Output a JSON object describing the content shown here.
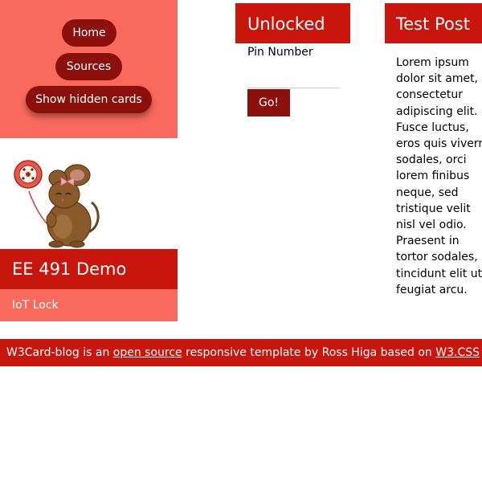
{
  "nav": {
    "home_label": "Home",
    "sources_label": "Sources",
    "hidden_cards_label": "Show hidden cards"
  },
  "profile": {
    "title": "EE 491 Demo",
    "subtitle": "IoT Lock",
    "mascot_icon": "mouse-with-balloon-icon"
  },
  "lock": {
    "status": "Unlocked",
    "pin_label": "Pin Number",
    "pin_value": "",
    "go_label": "Go!"
  },
  "post": {
    "title": "Test Post",
    "lines": [
      "Lorem ipsum",
      "dolor sit amet,",
      "consectetur",
      "adipiscing elit.",
      "Fusce luctus,",
      "eros quis viverra",
      "sodales, orci",
      "lorem finibus",
      "neque, sed",
      "tristique velit",
      "nisl vel odio.",
      "Praesent in",
      "tortor sodales,",
      "tincidunt elit ut,",
      "feugiat arcu."
    ]
  },
  "footer": {
    "text_before": "W3Card-blog is an ",
    "link1": "open source",
    "text_middle": " responsive template by Ross Higa based on ",
    "link2": "W3.CSS"
  },
  "colors": {
    "accent_red": "#c8160c",
    "dark_red": "#8b0f0a",
    "salmon": "#f96a5e"
  }
}
